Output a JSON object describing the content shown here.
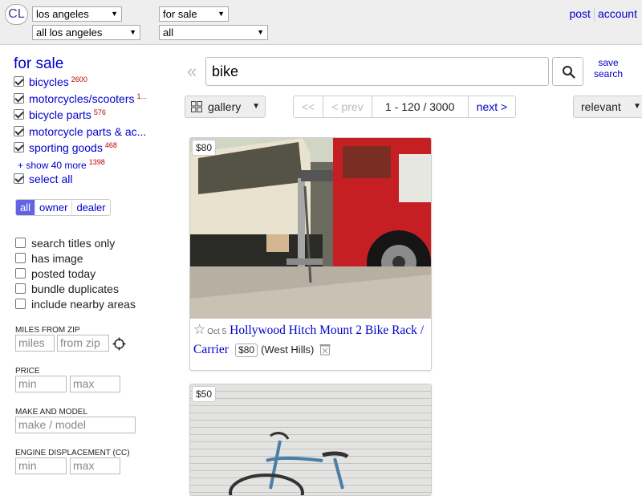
{
  "header": {
    "logo": "CL",
    "city": "los angeles",
    "area": "all los angeles",
    "section": "for sale",
    "filter": "all",
    "post_label": "post",
    "account_label": "account"
  },
  "sidebar": {
    "category_title": "for sale",
    "categories": [
      {
        "label": "bicycles",
        "count": "2600"
      },
      {
        "label": "motorcycles/scooters",
        "count": "1..."
      },
      {
        "label": "bicycle parts",
        "count": "576"
      },
      {
        "label": "motorcycle parts & ac...",
        "count": ""
      },
      {
        "label": "sporting goods",
        "count": "468"
      }
    ],
    "show_more": "+ show 40 more",
    "show_more_count": "1398",
    "select_all": "select all",
    "seller_tabs": [
      "all",
      "owner",
      "dealer"
    ],
    "options": [
      "search titles only",
      "has image",
      "posted today",
      "bundle duplicates",
      "include nearby areas"
    ],
    "miles_label": "MILES FROM ZIP",
    "miles_placeholder": "miles",
    "zip_placeholder": "from zip",
    "price_label": "PRICE",
    "min_placeholder": "min",
    "max_placeholder": "max",
    "make_label": "MAKE AND MODEL",
    "make_placeholder": "make / model",
    "engine_label": "ENGINE DISPLACEMENT (CC)",
    "engine_min": "min",
    "engine_max": "max"
  },
  "search": {
    "back_glyph": "«",
    "query": "bike",
    "save_line1": "save",
    "save_line2": "search"
  },
  "toolbar": {
    "view_label": "gallery",
    "first": "<<",
    "prev": "< prev",
    "range": "1 - 120 / 3000",
    "next": "next >",
    "sort": "relevant"
  },
  "listings": [
    {
      "price": "$80",
      "date": "Oct 5",
      "title": "Hollywood Hitch Mount 2 Bike Rack / Carrier",
      "price_inline": "$80",
      "location": "(West Hills)"
    },
    {
      "price": "$50"
    }
  ],
  "colors": {
    "link": "#0000cc",
    "count_red": "#bb0000",
    "active_tab": "#6264e3",
    "header_bg": "#eeeeee"
  }
}
